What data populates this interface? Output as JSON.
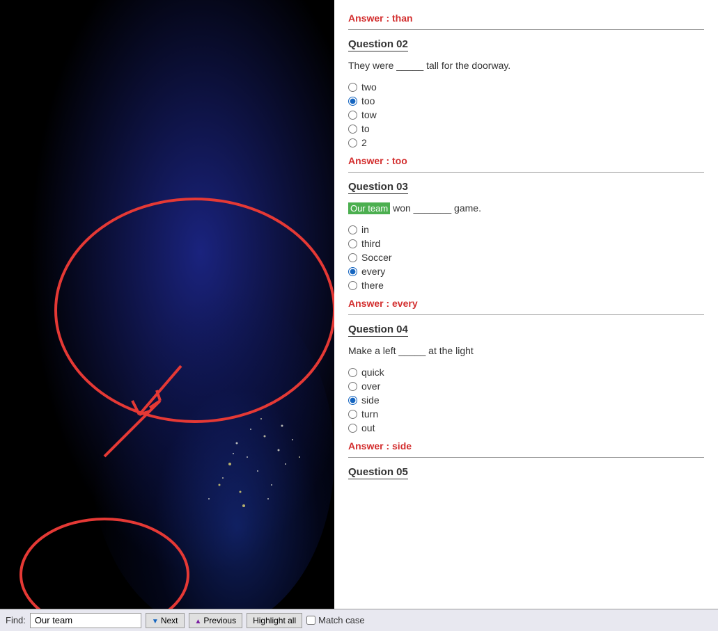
{
  "leftPanel": {
    "description": "Earth from space at night"
  },
  "questions": [
    {
      "id": "q01_answer",
      "answerLabel": "Answer : ",
      "answerValue": "than"
    },
    {
      "id": "q02",
      "title": "Question 02",
      "text_before": "They were _____ tall for the doorway.",
      "options": [
        {
          "label": "two",
          "selected": false
        },
        {
          "label": "too",
          "selected": true
        },
        {
          "label": "tow",
          "selected": false
        },
        {
          "label": "to",
          "selected": false
        },
        {
          "label": "2",
          "selected": false
        }
      ],
      "answerLabel": "Answer : ",
      "answerValue": "too"
    },
    {
      "id": "q03",
      "title": "Question 03",
      "text_highlight": "Our team",
      "text_after": " won _______ game.",
      "options": [
        {
          "label": "in",
          "selected": false
        },
        {
          "label": "third",
          "selected": false
        },
        {
          "label": "Soccer",
          "selected": false
        },
        {
          "label": "every",
          "selected": true
        },
        {
          "label": "there",
          "selected": false
        }
      ],
      "answerLabel": "Answer : ",
      "answerValue": "every"
    },
    {
      "id": "q04",
      "title": "Question 04",
      "text_before": "Make a left _____ at the light",
      "options": [
        {
          "label": "quick",
          "selected": false
        },
        {
          "label": "over",
          "selected": false
        },
        {
          "label": "side",
          "selected": true
        },
        {
          "label": "turn",
          "selected": false
        },
        {
          "label": "out",
          "selected": false
        }
      ],
      "answerLabel": "Answer : ",
      "answerValue": "side"
    },
    {
      "id": "q05",
      "title": "Question 05"
    }
  ],
  "findBar": {
    "label": "Find:",
    "inputValue": "Our team",
    "nextLabel": "Next",
    "previousLabel": "Previous",
    "highlightAllLabel": "Highlight all",
    "matchCaseLabel": "Match case"
  }
}
